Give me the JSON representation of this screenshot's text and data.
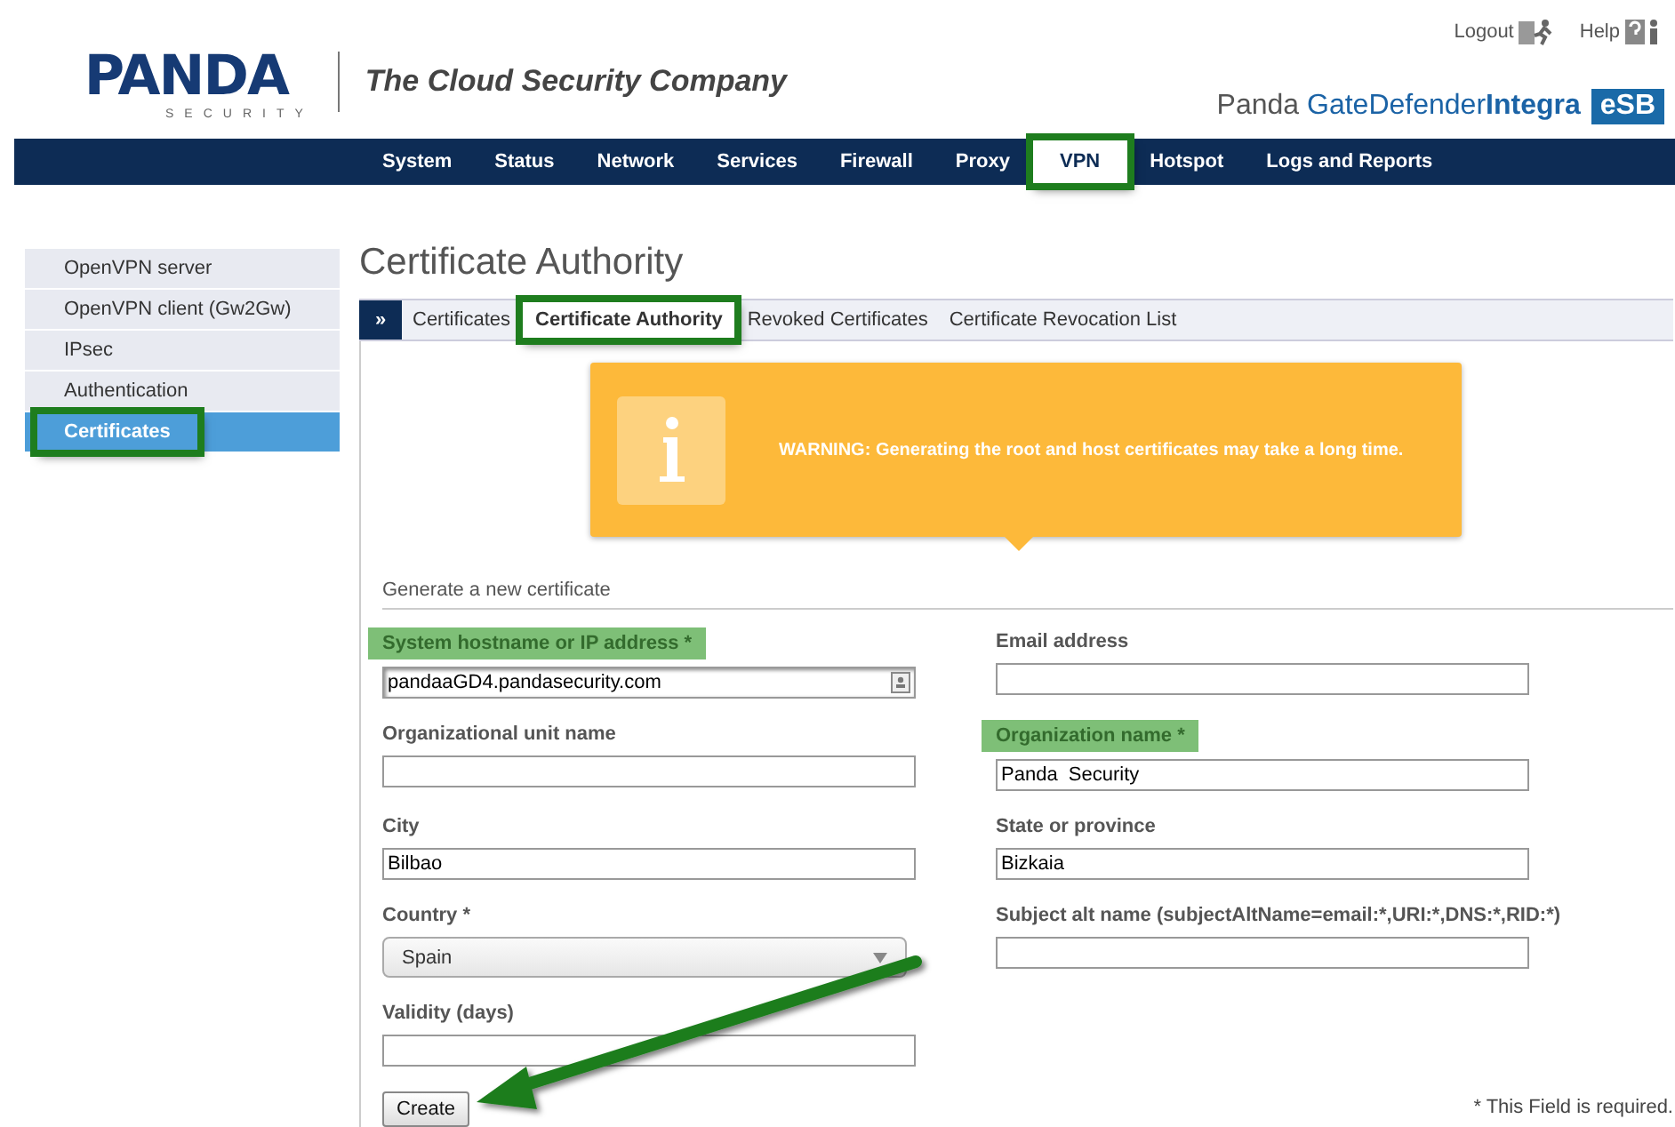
{
  "header": {
    "logo": "PANDA",
    "logo_sub": "SECURITY",
    "tagline": "The Cloud Security Company",
    "links": [
      {
        "label": "Logout",
        "kind": "logout"
      },
      {
        "label": "Help",
        "kind": "help"
      }
    ],
    "product": {
      "prefix": "Panda",
      "name": "GateDefender",
      "suffix": "Integra",
      "badge": "eSB"
    }
  },
  "nav": [
    {
      "label": "System",
      "selected": false,
      "highlighted": false
    },
    {
      "label": "Status",
      "selected": false,
      "highlighted": false
    },
    {
      "label": "Network",
      "selected": false,
      "highlighted": false
    },
    {
      "label": "Services",
      "selected": false,
      "highlighted": false
    },
    {
      "label": "Firewall",
      "selected": false,
      "highlighted": false
    },
    {
      "label": "Proxy",
      "selected": false,
      "highlighted": false
    },
    {
      "label": "VPN",
      "selected": true,
      "highlighted": true
    },
    {
      "label": "Hotspot",
      "selected": false,
      "highlighted": false
    },
    {
      "label": "Logs and Reports",
      "selected": false,
      "highlighted": false
    }
  ],
  "sidebar": [
    {
      "label": "OpenVPN server",
      "selected": false,
      "highlighted": false
    },
    {
      "label": "OpenVPN client (Gw2Gw)",
      "selected": false,
      "highlighted": false
    },
    {
      "label": "IPsec",
      "selected": false,
      "highlighted": false
    },
    {
      "label": "Authentication",
      "selected": false,
      "highlighted": false
    },
    {
      "label": "Certificates",
      "selected": true,
      "highlighted": true
    }
  ],
  "page_title": "Certificate Authority",
  "tab_toggle": "»",
  "tabs": [
    {
      "label": "Certificates",
      "selected": false,
      "highlighted": false
    },
    {
      "label": "Certificate Authority",
      "selected": true,
      "highlighted": true
    },
    {
      "label": "Revoked Certificates",
      "selected": false,
      "highlighted": false
    },
    {
      "label": "Certificate Revocation List",
      "selected": false,
      "highlighted": false
    }
  ],
  "warning": {
    "text": "WARNING: Generating the root and host certificates may take a long time."
  },
  "form": {
    "legend": "Generate a new certificate",
    "fields": [
      {
        "label": "System hostname or IP address *",
        "value": "pandaaGD4.pandasecurity.com",
        "kind": "autofill",
        "highlighted": true
      },
      {
        "label": "Email address",
        "kind": "text",
        "highlighted": false
      },
      {
        "label": "Organizational unit name",
        "kind": "text",
        "highlighted": false
      },
      {
        "label": "Organization name *",
        "value": "Panda  Security",
        "kind": "text",
        "highlighted": true
      },
      {
        "label": "City",
        "value": "Bilbao",
        "kind": "text",
        "highlighted": false
      },
      {
        "label": "State or province",
        "value": "Bizkaia",
        "kind": "text",
        "highlighted": false
      },
      {
        "label": "Country *",
        "value": "Spain",
        "kind": "select",
        "highlighted": false
      },
      {
        "label": "Subject alt name (subjectAltName=email:*,URI:*,DNS:*,RID:*)",
        "kind": "text",
        "highlighted": false
      },
      {
        "label": "Validity (days)",
        "kind": "text",
        "highlighted": false
      }
    ],
    "submit": {
      "label": "Create",
      "pointed_by_arrow": true
    },
    "required_note": "* This Field is required."
  }
}
